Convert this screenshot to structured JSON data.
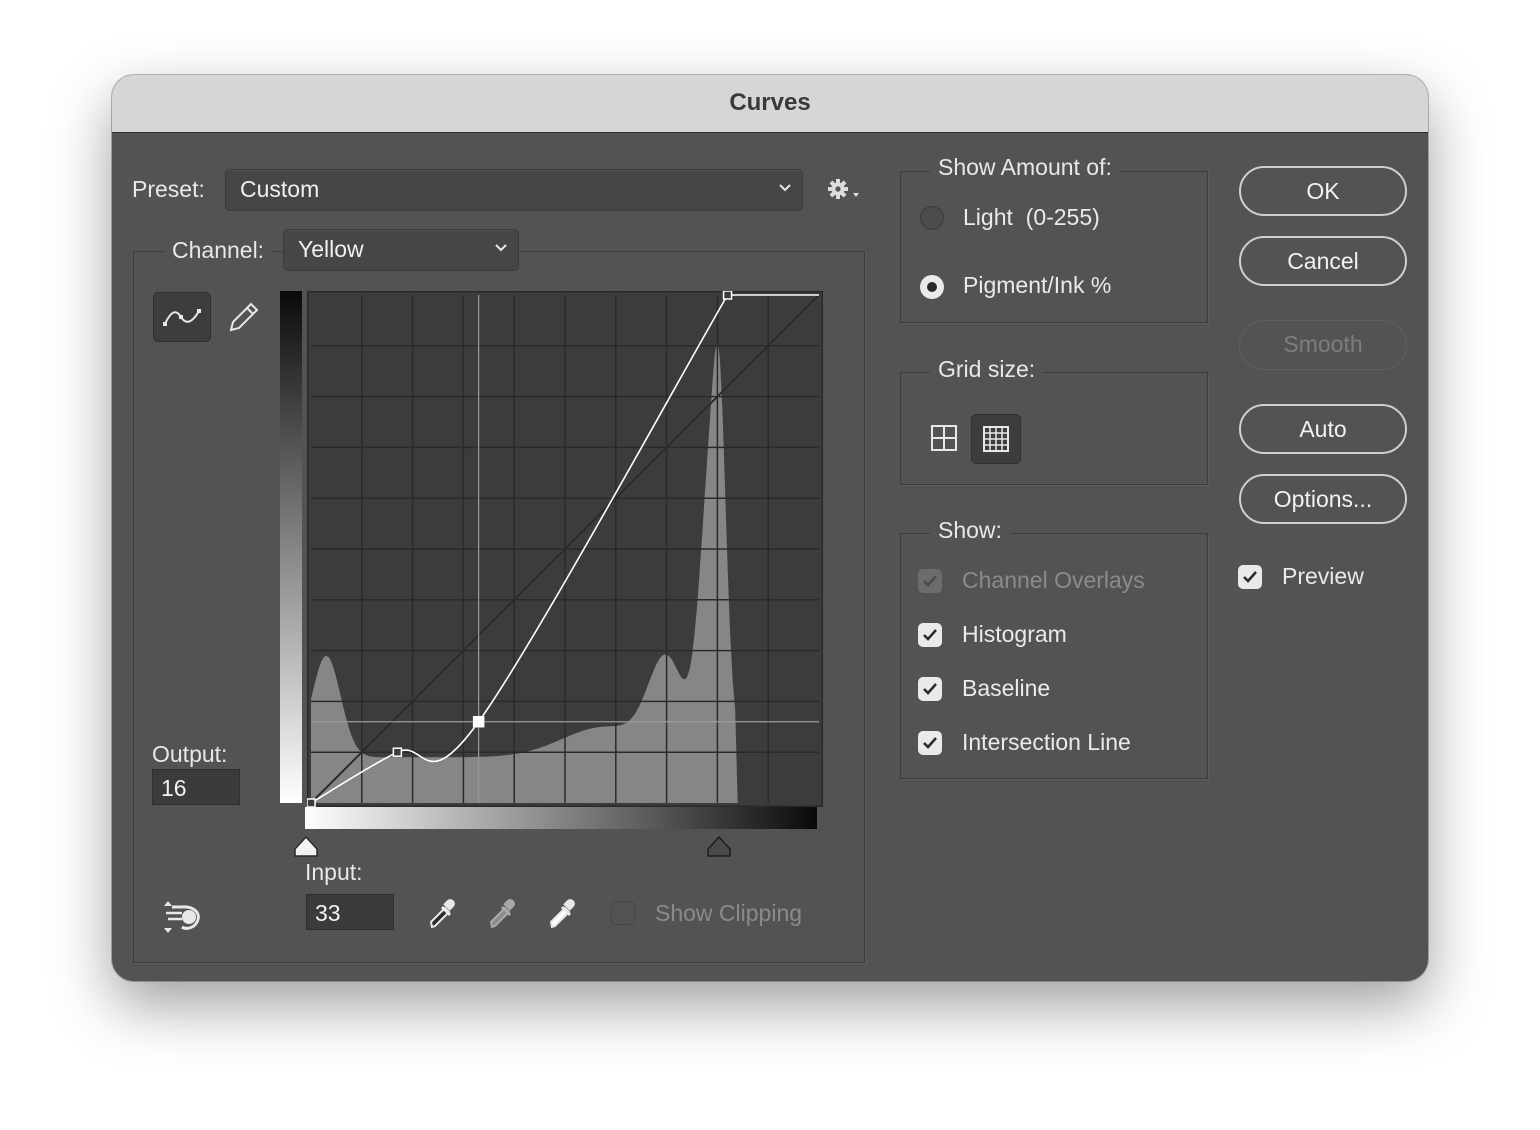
{
  "window": {
    "title": "Curves"
  },
  "preset": {
    "label": "Preset:",
    "value": "Custom",
    "settings_icon": "gear-icon"
  },
  "channel": {
    "label": "Channel:",
    "value": "Yellow"
  },
  "tools": {
    "curve_icon": "curve-tool-icon",
    "pencil_icon": "pencil-icon",
    "target_icon": "target-adjustment-icon"
  },
  "output": {
    "label": "Output:",
    "value": "16"
  },
  "input": {
    "label": "Input:",
    "value": "33"
  },
  "eyedroppers": [
    "black-point-eyedropper-icon",
    "gray-point-eyedropper-icon",
    "white-point-eyedropper-icon"
  ],
  "show_clipping": {
    "label": "Show Clipping",
    "checked": false,
    "enabled": false
  },
  "show_amount": {
    "legend": "Show Amount of:",
    "options": [
      {
        "label": "Light  (0-255)",
        "selected": false
      },
      {
        "label": "Pigment/Ink %",
        "selected": true
      }
    ]
  },
  "grid_size": {
    "legend": "Grid size:",
    "options": [
      "simple-grid-icon",
      "detailed-grid-icon"
    ],
    "selected": "detailed"
  },
  "show": {
    "legend": "Show:",
    "items": [
      {
        "label": "Channel Overlays",
        "checked": true,
        "enabled": false
      },
      {
        "label": "Histogram",
        "checked": true,
        "enabled": true
      },
      {
        "label": "Baseline",
        "checked": true,
        "enabled": true
      },
      {
        "label": "Intersection Line",
        "checked": true,
        "enabled": true
      }
    ]
  },
  "buttons": {
    "ok": "OK",
    "cancel": "Cancel",
    "smooth": "Smooth",
    "auto": "Auto",
    "options": "Options..."
  },
  "preview": {
    "label": "Preview",
    "checked": true
  },
  "curve": {
    "range": [
      0,
      100
    ],
    "points": [
      [
        0,
        0
      ],
      [
        17,
        10
      ],
      [
        33,
        16
      ],
      [
        82,
        100
      ]
    ],
    "selected_point": [
      33,
      16
    ],
    "colors": {
      "curve": "#ffffff",
      "histogram": "#868686",
      "background": "#3c3c3c",
      "grid": "#2a2a2a"
    }
  }
}
